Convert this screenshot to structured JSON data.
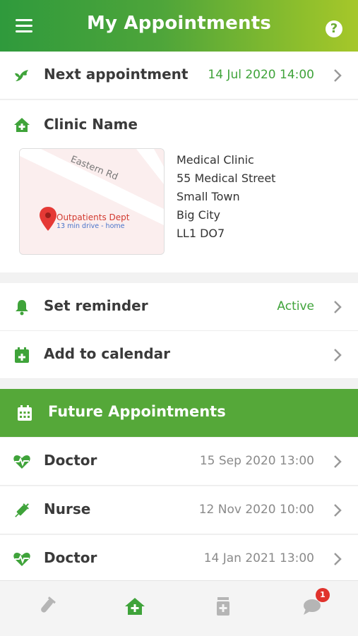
{
  "header": {
    "title": "My Appointments"
  },
  "next": {
    "label": "Next appointment",
    "date": "14 Jul 2020 14:00"
  },
  "clinic": {
    "label": "Clinic Name",
    "map": {
      "street": "Eastern Rd",
      "place": "Outpatients Dept",
      "drive": "13 min drive - home"
    },
    "address": [
      "Medical Clinic",
      "55 Medical Street",
      "Small Town",
      "Big City",
      "LL1 DO7"
    ]
  },
  "reminder": {
    "label": "Set reminder",
    "status": "Active"
  },
  "calendar": {
    "label": "Add to calendar"
  },
  "future": {
    "title": "Future Appointments",
    "items": [
      {
        "label": "Doctor",
        "date": "15 Sep 2020 13:00"
      },
      {
        "label": "Nurse",
        "date": "12 Nov 2020 10:00"
      },
      {
        "label": "Doctor",
        "date": "14 Jan 2021 13:00"
      }
    ]
  },
  "nav": {
    "badge": "1"
  },
  "colors": {
    "primary": "#55a839",
    "accent": "#3fa33a",
    "badge": "#e0322c"
  }
}
